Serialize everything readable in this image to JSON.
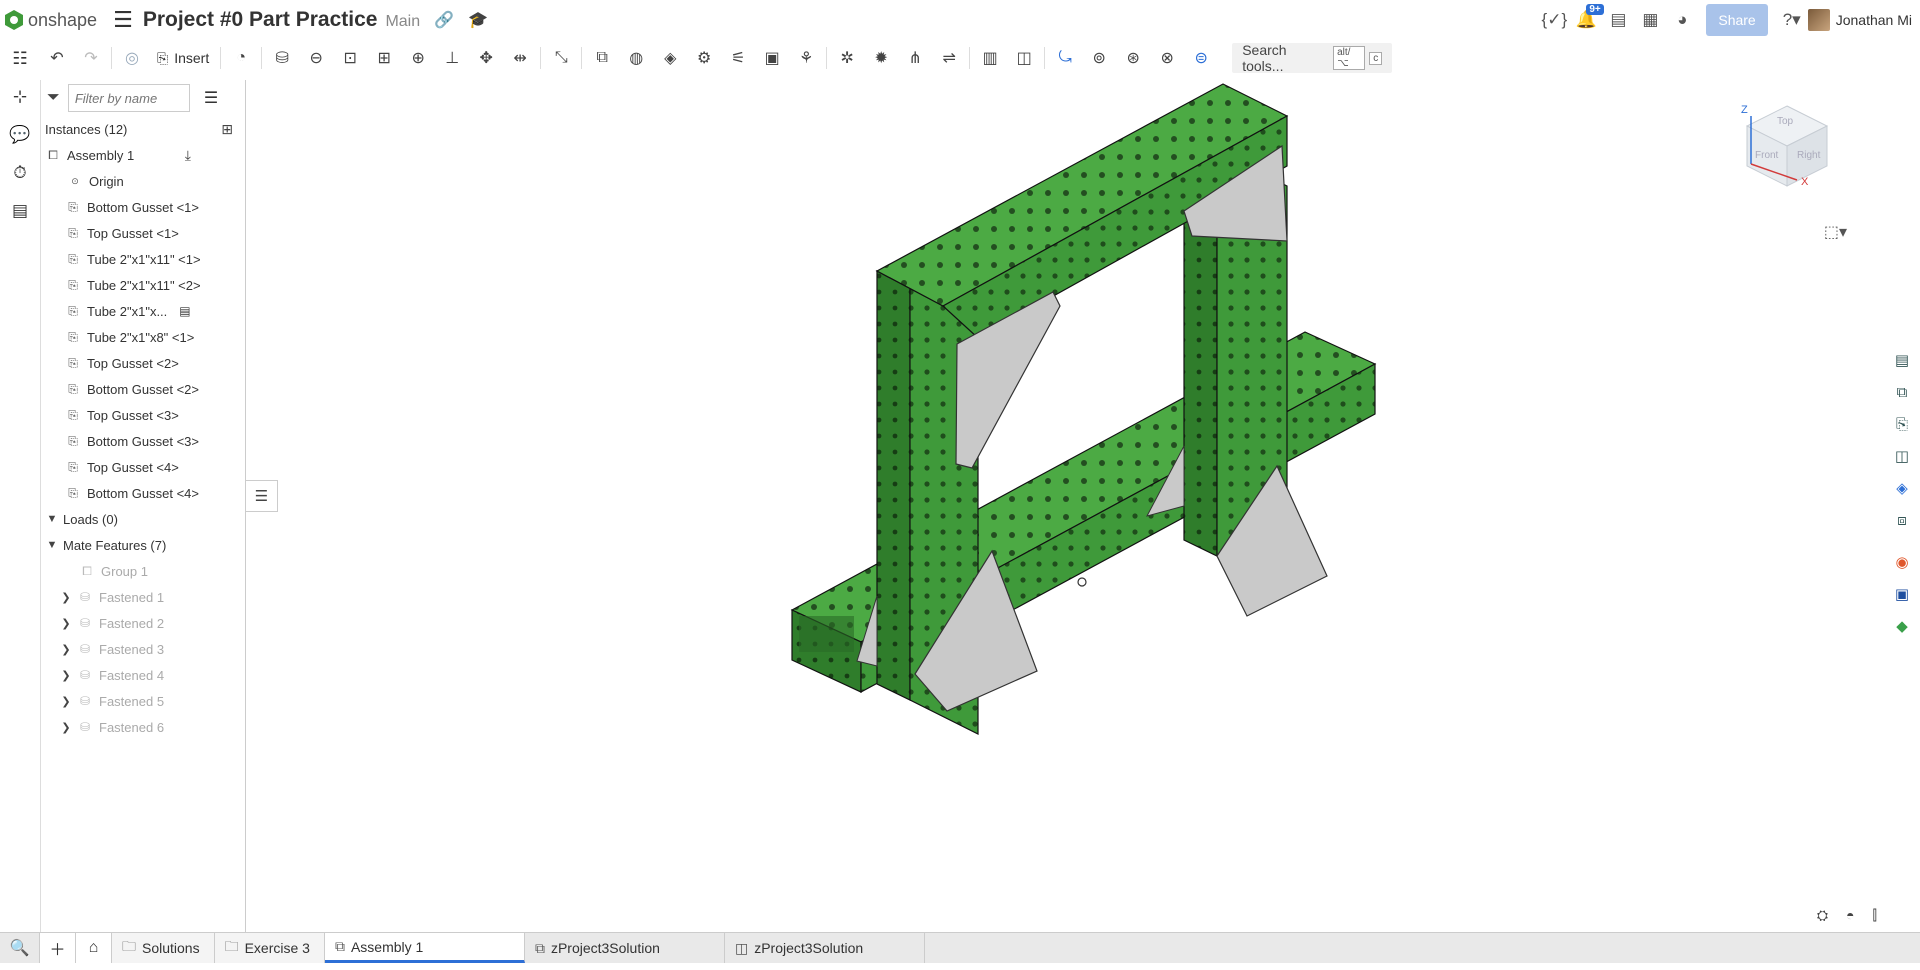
{
  "header": {
    "logo_text": "onshape",
    "title": "Project #0 Part Practice",
    "branch": "Main",
    "share_label": "Share",
    "notification_count": "9+",
    "user_name": "Jonathan Mi"
  },
  "toolbar": {
    "insert_label": "Insert",
    "search_label": "Search tools...",
    "search_kbd1": "alt/⌥",
    "search_kbd2": "c"
  },
  "panel": {
    "filter_placeholder": "Filter by name",
    "instances_label": "Instances (12)",
    "assembly_label": "Assembly 1",
    "origin_label": "Origin",
    "instances": [
      "Bottom Gusset <1>",
      "Top Gusset <1>",
      "Tube 2\"x1\"x11\" <1>",
      "Tube 2\"x1\"x11\" <2>",
      "Tube 2\"x1\"x...",
      "Tube 2\"x1\"x8\" <1>",
      "Top Gusset <2>",
      "Bottom Gusset <2>",
      "Top Gusset <3>",
      "Bottom Gusset <3>",
      "Top Gusset <4>",
      "Bottom Gusset <4>"
    ],
    "loads_label": "Loads (0)",
    "mates_label": "Mate Features (7)",
    "group_label": "Group 1",
    "fastened": [
      "Fastened 1",
      "Fastened 2",
      "Fastened 3",
      "Fastened 4",
      "Fastened 5",
      "Fastened 6"
    ]
  },
  "viewcube": {
    "top": "Top",
    "front": "Front",
    "right": "Right",
    "x": "X",
    "z": "Z"
  },
  "bottom": {
    "crumbs": [
      "Solutions",
      "Exercise 3"
    ],
    "tabs": [
      "Assembly 1",
      "zProject3Solution",
      "zProject3Solution"
    ]
  },
  "colors": {
    "accent": "#2d6fd6",
    "tube_green": "#3f9a3a",
    "gusset_gray": "#c9c9c9"
  }
}
